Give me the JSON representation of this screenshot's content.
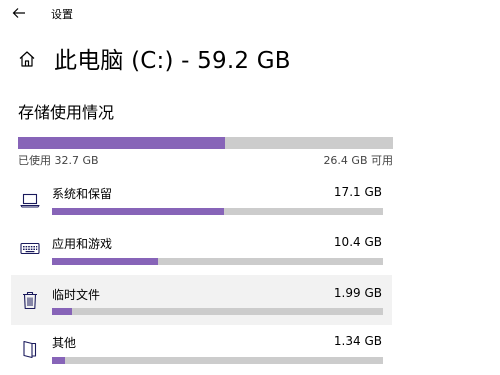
{
  "window": {
    "title": "设置"
  },
  "header": {
    "page_title": "此电脑 (C:) - 59.2 GB",
    "section_title": "存储使用情况"
  },
  "overall": {
    "used_label": "已使用 32.7 GB",
    "free_label": "26.4 GB 可用",
    "used_fraction": 0.552
  },
  "categories": [
    {
      "name": "系统和保留",
      "size": "17.1 GB",
      "fraction": 0.52,
      "icon": "laptop-icon"
    },
    {
      "name": "应用和游戏",
      "size": "10.4 GB",
      "fraction": 0.32,
      "icon": "keyboard-icon"
    },
    {
      "name": "临时文件",
      "size": "1.99 GB",
      "fraction": 0.06,
      "icon": "trash-icon"
    },
    {
      "name": "其他",
      "size": "1.34 GB",
      "fraction": 0.04,
      "icon": "document-icon"
    }
  ],
  "colors": {
    "accent": "#8764b8",
    "track": "#cccccc",
    "hover_row": "#f2f2f2"
  }
}
